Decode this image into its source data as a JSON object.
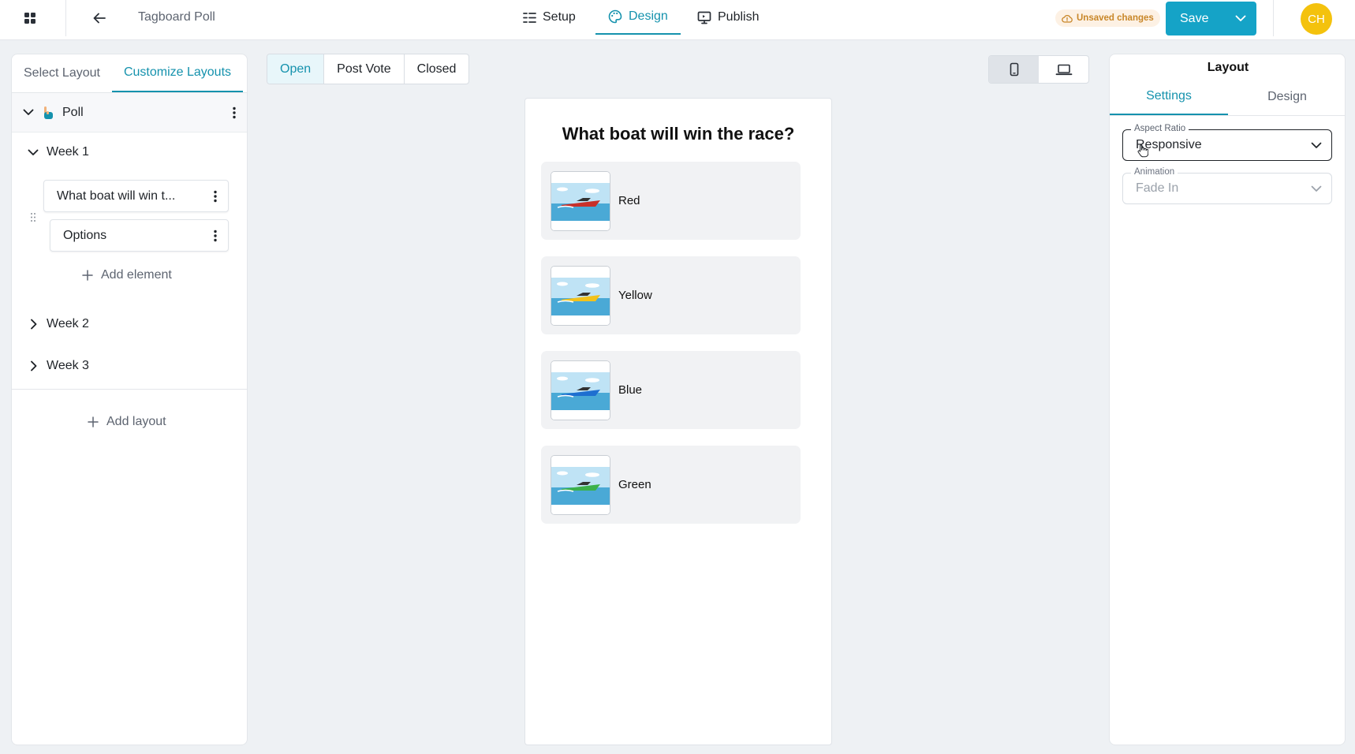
{
  "topbar": {
    "app_title": "Tagboard Poll",
    "nav": [
      {
        "label": "Setup",
        "icon": "list-icon"
      },
      {
        "label": "Design",
        "icon": "palette-icon",
        "active": true
      },
      {
        "label": "Publish",
        "icon": "monitor-icon"
      }
    ],
    "unsaved": "Unsaved changes",
    "save_label": "Save",
    "avatar_initials": "CH"
  },
  "left_panel": {
    "tabs": [
      {
        "label": "Select Layout"
      },
      {
        "label": "Customize Layouts",
        "active": true
      }
    ],
    "poll_label": "Poll",
    "weeks": [
      {
        "label": "Week 1",
        "expanded": true
      },
      {
        "label": "Week 2",
        "expanded": false
      },
      {
        "label": "Week 3",
        "expanded": false
      }
    ],
    "elements": [
      {
        "label": "What boat will win t..."
      },
      {
        "label": "Options"
      }
    ],
    "add_element": "Add element",
    "add_layout": "Add layout"
  },
  "states": [
    {
      "label": "Open",
      "active": true
    },
    {
      "label": "Post Vote"
    },
    {
      "label": "Closed"
    }
  ],
  "preview": {
    "question": "What boat will win the race?",
    "options": [
      {
        "label": "Red",
        "boat_color": "#c8302a"
      },
      {
        "label": "Yellow",
        "boat_color": "#f2c21b"
      },
      {
        "label": "Blue",
        "boat_color": "#1e6fd0"
      },
      {
        "label": "Green",
        "boat_color": "#3bb14a"
      }
    ]
  },
  "right_panel": {
    "title": "Layout",
    "tabs": [
      {
        "label": "Settings",
        "active": true
      },
      {
        "label": "Design"
      }
    ],
    "aspect_ratio": {
      "label": "Aspect Ratio",
      "value": "Responsive"
    },
    "animation": {
      "label": "Animation",
      "value": "Fade In"
    }
  },
  "colors": {
    "accent": "#1592ad",
    "save": "#15a3c7",
    "avatar": "#f4c20d",
    "unsaved_text": "#c88628"
  }
}
